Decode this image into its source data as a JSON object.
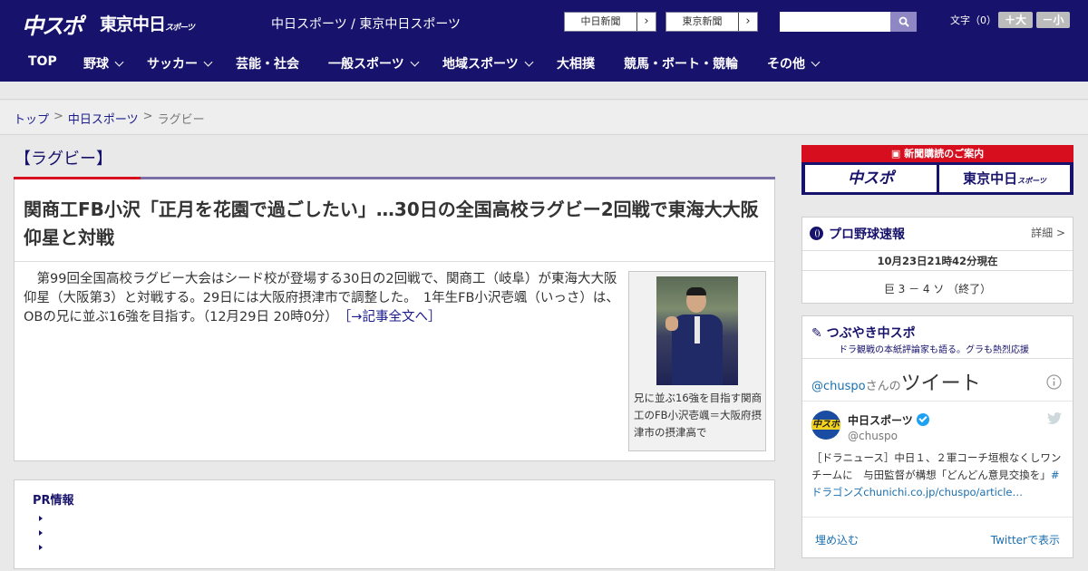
{
  "header": {
    "logo_chuspo": "中スポ",
    "logo_tokyo": "東京中日",
    "logo_tokyo_sub": "スポーツ",
    "site_title": "中日スポーツ / 東京中日スポーツ",
    "ext_links": [
      {
        "label": "中日新聞",
        "arrow": "›"
      },
      {
        "label": "東京新聞",
        "arrow": "›"
      }
    ],
    "search": {
      "placeholder": "",
      "icon": "search-icon"
    },
    "font_size_label": "文字（0）",
    "font_bigger": "＋大",
    "font_smaller": "－小"
  },
  "nav": {
    "items": [
      {
        "label": "TOP",
        "dropdown": false
      },
      {
        "label": "野球",
        "dropdown": true
      },
      {
        "label": "サッカー",
        "dropdown": true
      },
      {
        "label": "芸能・社会",
        "dropdown": false
      },
      {
        "label": "一般スポーツ",
        "dropdown": true
      },
      {
        "label": "地域スポーツ",
        "dropdown": true
      },
      {
        "label": "大相撲",
        "dropdown": false
      },
      {
        "label": "競馬・ボート・競輪",
        "dropdown": false
      },
      {
        "label": "その他",
        "dropdown": true
      }
    ]
  },
  "breadcrumb": {
    "items": [
      "トップ",
      "中日スポーツ",
      "ラグビー"
    ],
    "separator": ">"
  },
  "section_title": "【ラグビー】",
  "article": {
    "headline": "関商工FB小沢「正月を花園で過ごしたい」…30日の全国高校ラグビー2回戦で東海大大阪仰星と対戦",
    "body": "第99回全国高校ラグビー大会はシード校が登場する30日の2回戦で、関商工（岐阜）が東海大大阪仰星（大阪第3）と対戦する。29日には大阪府摂津市で調整した。　1年生FB小沢壱颯（いっさ）は、OBの兄に並ぶ16強を目指す。（12月29日 20時0分）",
    "read_more": "［→記事全文へ］",
    "photo_caption": "兄に並ぶ16強を目指す関商工のFB小沢壱颯＝大阪府摂津市の摂津高で"
  },
  "pr": {
    "title": "PR情報",
    "items": [
      "",
      "",
      ""
    ]
  },
  "sidebar": {
    "banner_top": "新聞購読のご案内",
    "banner_left": "中スポ",
    "banner_right": "東京中日",
    "banner_right_sub": "スポーツ",
    "baseball": {
      "title": "プロ野球速報",
      "detail": "詳細 >",
      "updated": "10月23日21時42分現在",
      "score": "巨 3 － 4 ソ （終了）"
    },
    "tweets": {
      "title": "つぶやき中スポ",
      "subtitle": "ドラ観戦の本紙評論家も語る。グラも熱烈応援",
      "handle_prefix": "@chuspo",
      "handle_suffix": "さんの",
      "tweets_label": "ツイート",
      "account_name": "中日スポーツ",
      "account_handle": "@chuspo",
      "tweet_text": "［ドラニュース］中日１、２軍コーチ垣根なくしワンチームに　与田監督が構想「どんどん意見交換を」",
      "tweet_link": "#ドラゴンズchunichi.co.jp/chuspo/article…",
      "embed": "埋め込む",
      "view_on": "Twitterで表示"
    }
  },
  "colors": {
    "brand_navy": "#17126b",
    "accent_red": "#d60e1e",
    "link": "#1a1a8c",
    "twitter_blue": "#1da1f2"
  }
}
